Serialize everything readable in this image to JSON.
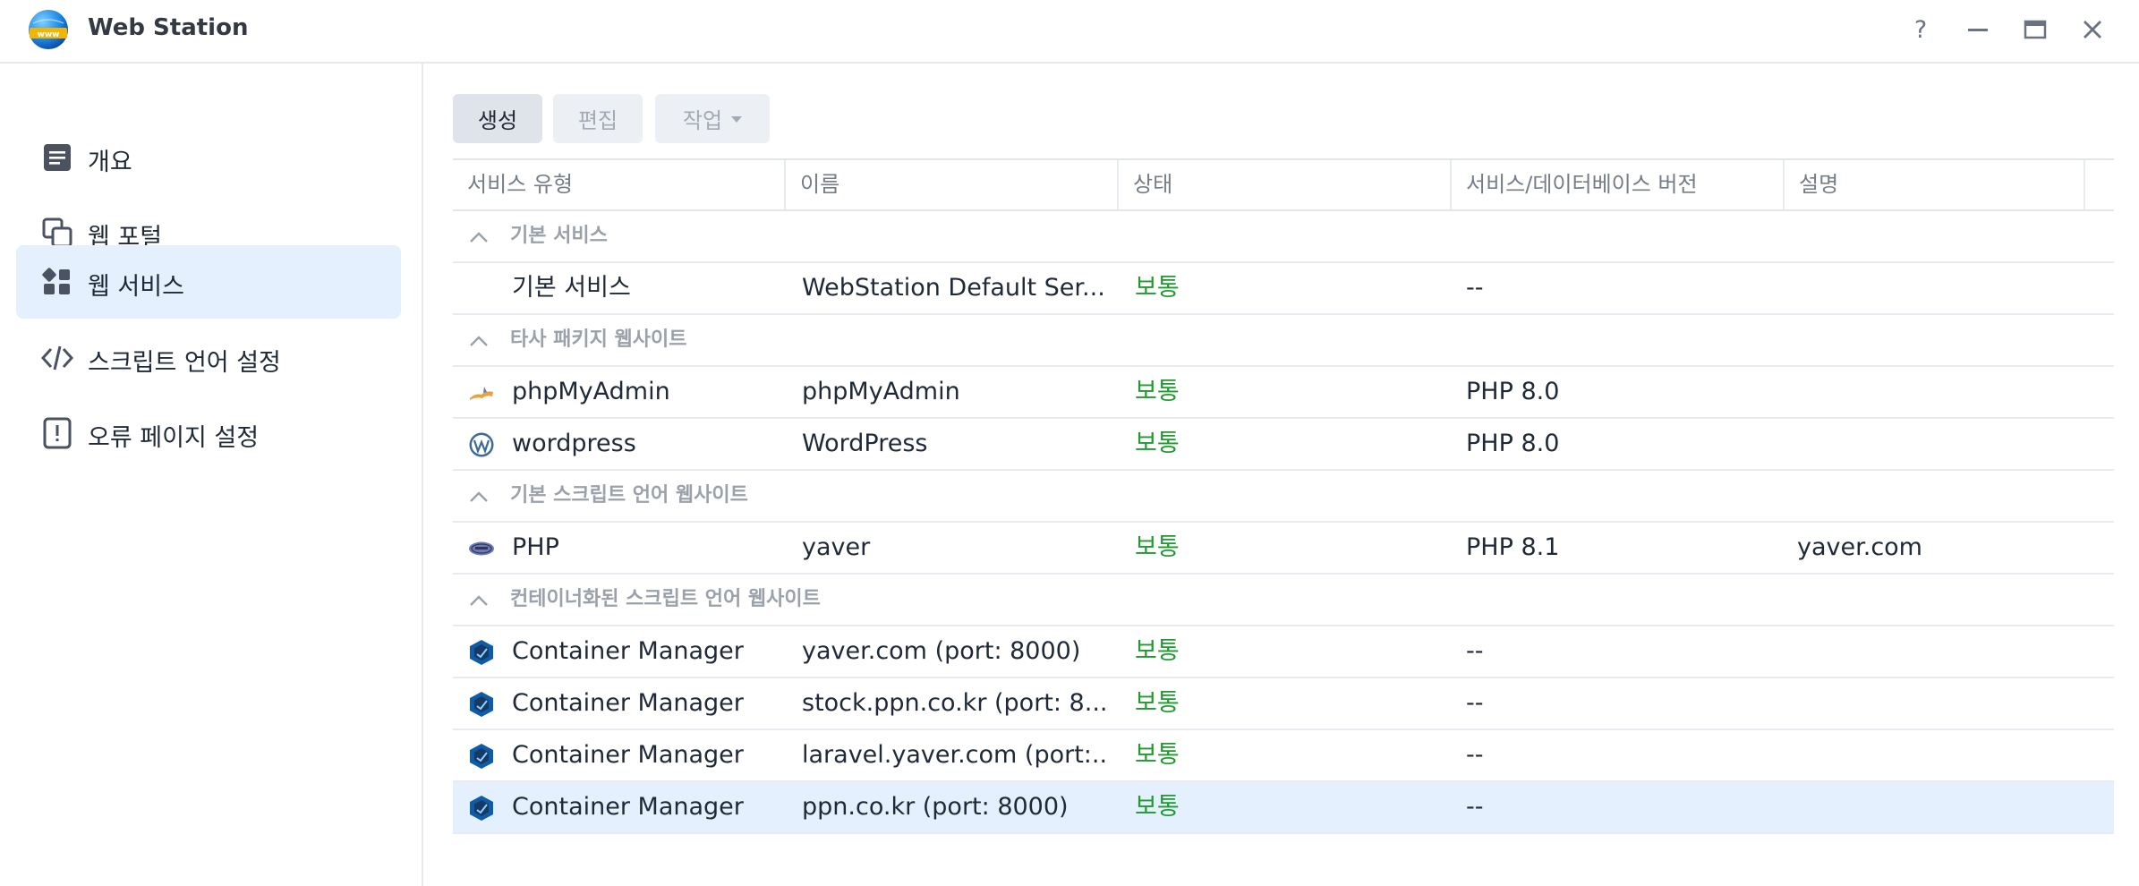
{
  "window": {
    "title": "Web Station",
    "help_label": "?"
  },
  "colors": {
    "accent": "#e4f0fd",
    "status_ok": "#1f9a2e",
    "group_text": "#9aa1ab"
  },
  "sidebar": {
    "items": [
      {
        "label": "개요",
        "icon": "overview-icon",
        "active": false
      },
      {
        "label": "웹 포털",
        "icon": "web-portal-icon",
        "active": false
      },
      {
        "label": "웹 서비스",
        "icon": "web-service-icon",
        "active": true
      },
      {
        "label": "스크립트 언어 설정",
        "icon": "code-icon",
        "active": false
      },
      {
        "label": "오류 페이지 설정",
        "icon": "error-page-icon",
        "active": false
      }
    ]
  },
  "toolbar": {
    "create_label": "생성",
    "edit_label": "편집",
    "action_label": "작업"
  },
  "table": {
    "columns": [
      "서비스 유형",
      "이름",
      "상태",
      "서비스/데이터베이스 버전",
      "설명"
    ],
    "groups": [
      {
        "label": "기본 서비스",
        "rows": [
          {
            "type": "기본 서비스",
            "icon": "none",
            "name": "WebStation Default Ser...",
            "status": "보통",
            "version": "--",
            "description": ""
          }
        ]
      },
      {
        "label": "타사 패키지 웹사이트",
        "rows": [
          {
            "type": "phpMyAdmin",
            "icon": "phpmyadmin-icon",
            "name": "phpMyAdmin",
            "status": "보통",
            "version": "PHP 8.0",
            "description": ""
          },
          {
            "type": "wordpress",
            "icon": "wordpress-icon",
            "name": "WordPress",
            "status": "보통",
            "version": "PHP 8.0",
            "description": ""
          }
        ]
      },
      {
        "label": "기본 스크립트 언어 웹사이트",
        "rows": [
          {
            "type": "PHP",
            "icon": "php-icon",
            "name": "yaver",
            "status": "보통",
            "version": "PHP 8.1",
            "description": "yaver.com"
          }
        ]
      },
      {
        "label": "컨테이너화된 스크립트 언어 웹사이트",
        "rows": [
          {
            "type": "Container Manager",
            "icon": "container-manager-icon",
            "name": "yaver.com (port: 8000)",
            "status": "보통",
            "version": "--",
            "description": ""
          },
          {
            "type": "Container Manager",
            "icon": "container-manager-icon",
            "name": "stock.ppn.co.kr (port: 8...",
            "status": "보통",
            "version": "--",
            "description": ""
          },
          {
            "type": "Container Manager",
            "icon": "container-manager-icon",
            "name": "laravel.yaver.com (port:...",
            "status": "보통",
            "version": "--",
            "description": ""
          },
          {
            "type": "Container Manager",
            "icon": "container-manager-icon",
            "name": "ppn.co.kr (port: 8000)",
            "status": "보통",
            "version": "--",
            "description": "",
            "selected": true
          }
        ]
      }
    ]
  }
}
